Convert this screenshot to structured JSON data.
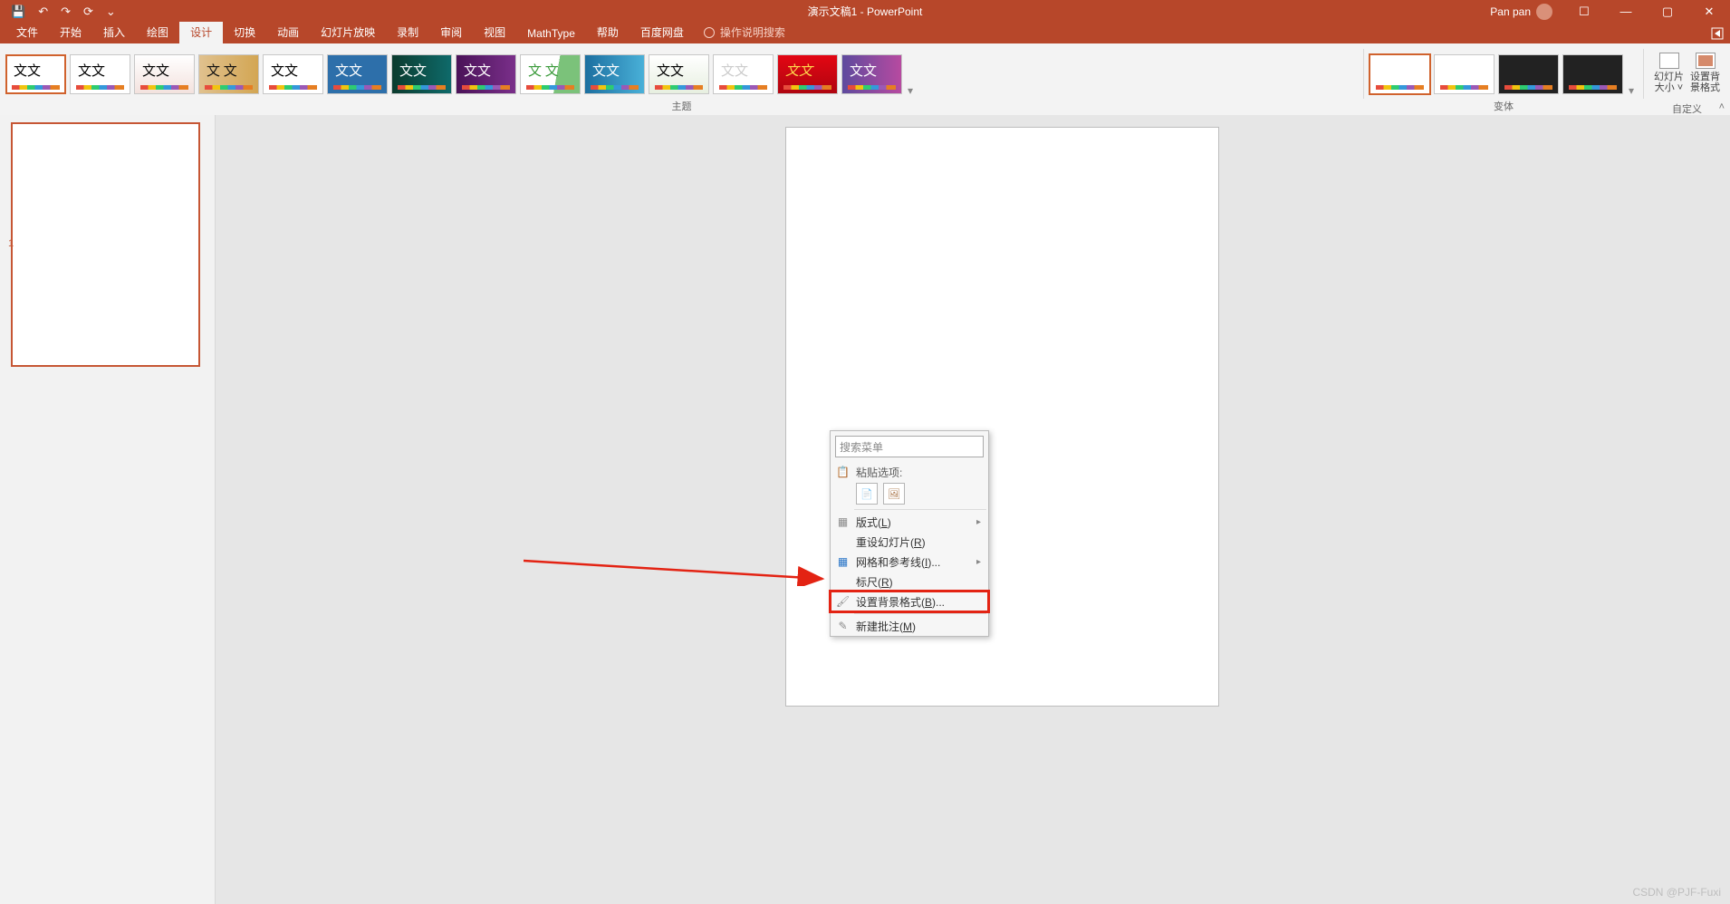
{
  "titlebar": {
    "title": "演示文稿1 - PowerPoint",
    "qat": {
      "save": "💾",
      "undo": "↶",
      "redo": "↷",
      "startover": "⟳",
      "touch": "⌄"
    }
  },
  "user": {
    "name": "Pan pan"
  },
  "win": {
    "opts": "☐",
    "min": "—",
    "max": "▢",
    "close": "✕"
  },
  "tabs": {
    "file": "文件",
    "home": "开始",
    "insert": "插入",
    "draw": "绘图",
    "design": "设计",
    "transition": "切换",
    "animation": "动画",
    "slideshow": "幻灯片放映",
    "record": "录制",
    "review": "审阅",
    "view": "视图",
    "mathtype": "MathType",
    "help": "帮助",
    "baidu": "百度网盘",
    "tellme": "操作说明搜索"
  },
  "ribbon": {
    "themes_group": "主题",
    "variants_group": "变体",
    "custom_group": "自定义",
    "slide_size": "幻灯片\n大小 ˅",
    "bg_format": "设置背\n景格式"
  },
  "slidepanel": {
    "num": "1"
  },
  "context_menu": {
    "search_placeholder": "搜索菜单",
    "paste_header": "粘贴选项:",
    "layout": "版式(L)",
    "reset": "重设幻灯片(R)",
    "grid": "网格和参考线(I)...",
    "ruler": "标尺(R)",
    "format_bg": "设置背景格式(B)...",
    "new_comment": "新建批注(M)"
  },
  "watermark": "CSDN @PJF-Fuxi"
}
